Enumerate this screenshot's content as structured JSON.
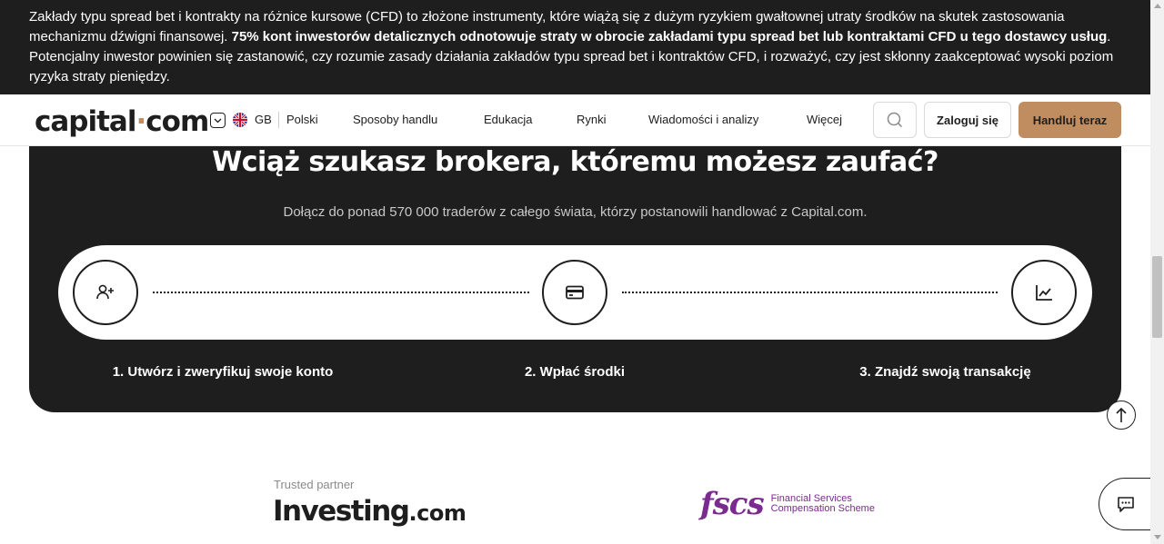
{
  "risk_banner": {
    "text_before": "Zakłady typu spread bet i kontrakty na różnice kursowe (CFD) to złożone instrumenty, które wiążą się z dużym ryzykiem gwałtownej utraty środków na skutek zastosowania mechanizmu dźwigni finansowej. ",
    "text_bold": "75% kont inwestorów detalicznych odnotowuje straty w obrocie zakładami typu spread bet lub kontraktami CFD u tego dostawcy usług",
    "text_after": ". Potencjalny inwestor powinien się zastanowić, czy rozumie zasady działania zakładów typu spread bet i kontraktów CFD, i rozważyć, czy jest skłonny zaakceptować wysoki poziom ryzyka straty pieniędzy."
  },
  "header": {
    "logo_left": "capital",
    "logo_dot": "·",
    "logo_right": "com",
    "region": "GB",
    "language": "Polski",
    "nav": [
      "Sposoby handlu",
      "Edukacja",
      "Rynki",
      "Wiadomości i analizy",
      "Więcej"
    ],
    "login_label": "Zaloguj się",
    "trade_label": "Handluj teraz"
  },
  "hero": {
    "title": "Wciąż szukasz brokera, któremu możesz zaufać?",
    "subtitle": "Dołącz do ponad 570 000 traderów z całego świata, którzy postanowili handlować z Capital.com.",
    "steps": [
      {
        "label": "1. Utwórz i zweryfikuj swoje konto",
        "icon": "add-user-icon"
      },
      {
        "label": "2. Wpłać środki",
        "icon": "credit-card-icon"
      },
      {
        "label": "3. Znajdź swoją transakcję",
        "icon": "chart-line-icon"
      }
    ]
  },
  "partners": {
    "trusted_label": "Trusted partner",
    "investing_main": "Investing",
    "investing_suffix": ".com",
    "fscs_mark": "fscs",
    "fscs_line1": "Financial Services",
    "fscs_line2": "Compensation Scheme"
  },
  "colors": {
    "dark": "#1e1e1e",
    "accent": "#c08d60",
    "fscs_purple": "#7b2a8f"
  }
}
